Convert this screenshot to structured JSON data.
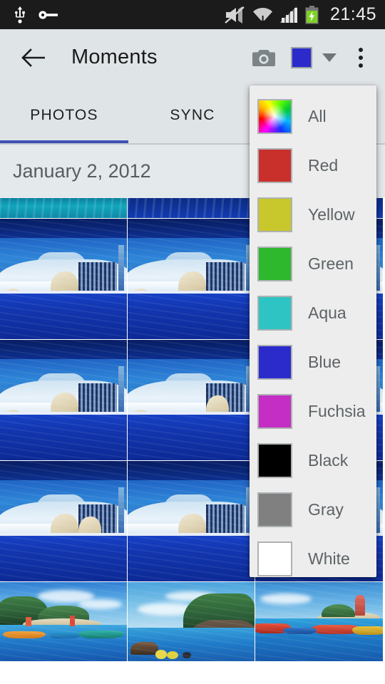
{
  "statusbar": {
    "time": "21:45",
    "icons": [
      "usb-icon",
      "vpn-key-icon",
      "volume-mute-icon",
      "wifi-icon",
      "signal-icon",
      "battery-charging-icon"
    ]
  },
  "appbar": {
    "back_icon": "arrow-back-icon",
    "title": "Moments",
    "camera_icon": "camera-icon",
    "current_color": "#2b2bcc",
    "caret_icon": "chevron-down-icon",
    "overflow_icon": "overflow-menu-icon"
  },
  "tabs": [
    {
      "label": "PHOTOS",
      "active": true
    },
    {
      "label": "SYNC",
      "active": false
    }
  ],
  "content": {
    "date_header": "January 2, 2012"
  },
  "color_menu": {
    "open": true,
    "items": [
      {
        "label": "All",
        "color": "rainbow"
      },
      {
        "label": "Red",
        "color": "#c9302c"
      },
      {
        "label": "Yellow",
        "color": "#c8c72c"
      },
      {
        "label": "Green",
        "color": "#2eb82e"
      },
      {
        "label": "Aqua",
        "color": "#2ec4c4"
      },
      {
        "label": "Blue",
        "color": "#2b2bcc"
      },
      {
        "label": "Fuchsia",
        "color": "#c42ec4"
      },
      {
        "label": "Black",
        "color": "#000000"
      },
      {
        "label": "Gray",
        "color": "#808080"
      },
      {
        "label": "White",
        "color": "#ffffff"
      }
    ]
  },
  "theme": {
    "accent": "#3f51b5",
    "appbar_bg": "#dfe4e7",
    "menu_bg": "#ededed",
    "status_bg": "#1b1b1b",
    "date_header_bg": "#e4e9eb"
  },
  "photo_grid": {
    "rows": [
      {
        "type": "strip",
        "cells": [
          "polar-bear-pool-teal",
          "polar-bear-pool-blue",
          "polar-bear-pool-blue"
        ]
      },
      {
        "type": "tall",
        "cells": [
          "polar-bear-enclosure-1",
          "polar-bear-enclosure-2",
          "polar-bear-enclosure-3"
        ]
      },
      {
        "type": "tall",
        "cells": [
          "polar-bear-enclosure-4",
          "polar-bear-enclosure-5",
          "polar-bear-enclosure-6"
        ]
      },
      {
        "type": "tall",
        "cells": [
          "polar-bear-enclosure-7",
          "polar-bear-enclosure-8",
          "polar-bear-enclosure-9"
        ]
      },
      {
        "type": "bottom",
        "cells": [
          "tropical-beach-boats",
          "tropical-cliff-cove",
          "tropical-island-lighthouse"
        ]
      }
    ]
  }
}
